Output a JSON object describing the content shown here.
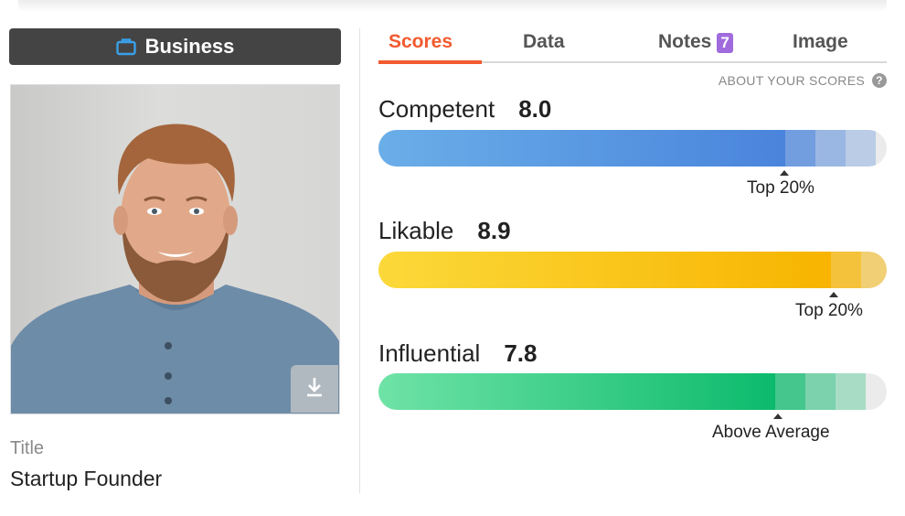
{
  "category": {
    "label": "Business",
    "icon": "briefcase-icon",
    "color": "#444444"
  },
  "photo": {
    "alt": "Portrait photo",
    "download_icon": "download-icon"
  },
  "profile": {
    "title_label": "Title",
    "title_value": "Startup Founder"
  },
  "tabs": [
    {
      "label": "Scores",
      "active": true
    },
    {
      "label": "Data",
      "active": false
    },
    {
      "label": "Notes",
      "active": false,
      "badge": "7"
    },
    {
      "label": "Image",
      "active": false
    }
  ],
  "about_link": "ABOUT YOUR SCORES",
  "accent_color": "#f25a2f",
  "scores": [
    {
      "name": "Competent",
      "value": "8.0",
      "score": 8.0,
      "percentile_label": "Top 20%",
      "colors": [
        "#6aaee8",
        "#4a84dc"
      ]
    },
    {
      "name": "Likable",
      "value": "8.9",
      "score": 8.9,
      "percentile_label": "Top 20%",
      "colors": [
        "#fbd93a",
        "#f8b400"
      ]
    },
    {
      "name": "Influential",
      "value": "7.8",
      "score": 7.8,
      "percentile_label": "Above Average",
      "colors": [
        "#6fe3a6",
        "#0cba6d"
      ]
    }
  ]
}
